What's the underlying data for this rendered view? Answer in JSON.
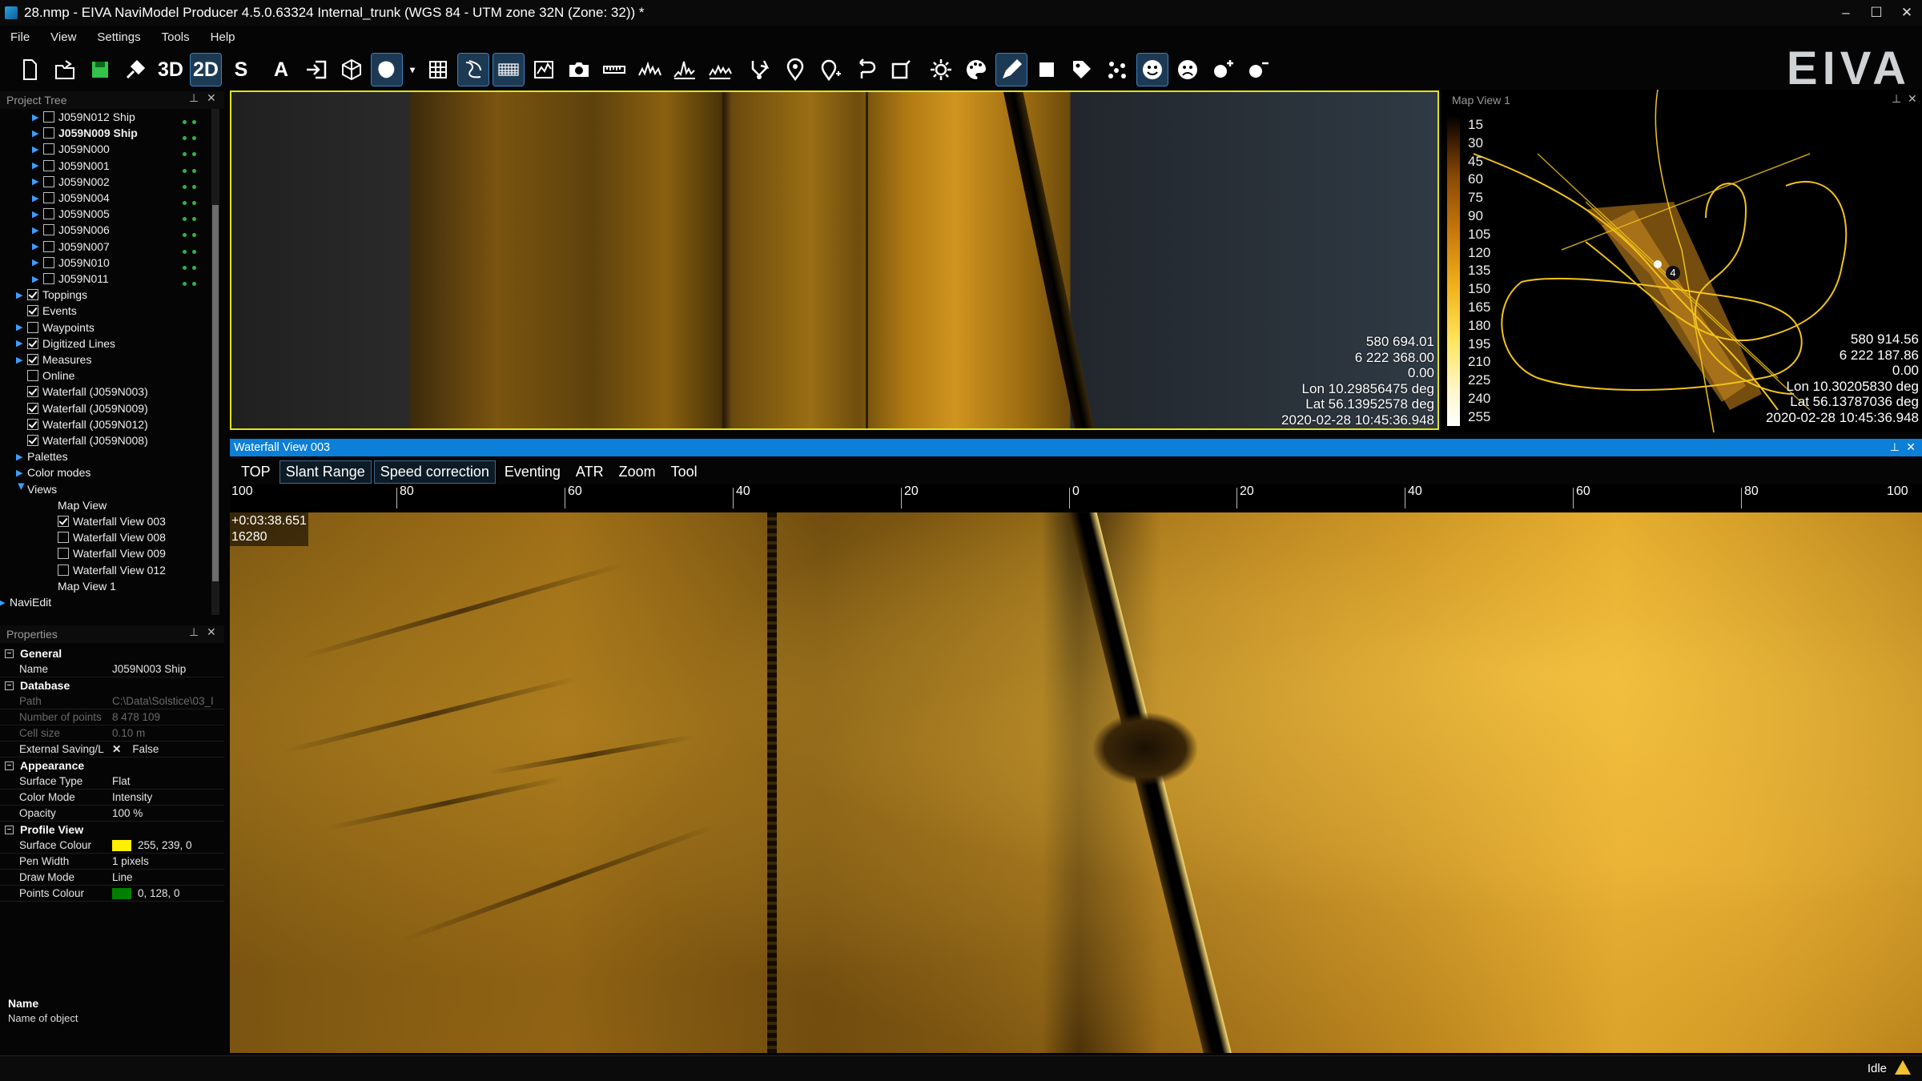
{
  "window": {
    "title": "28.nmp - EIVA NaviModel Producer 4.5.0.63324 Internal_trunk (WGS 84 - UTM zone 32N (Zone: 32)) *",
    "minimize": "–",
    "maximize": "☐",
    "close": "✕",
    "logo": "EIVA"
  },
  "menu": [
    "File",
    "View",
    "Settings",
    "Tools",
    "Help"
  ],
  "toolbar": {
    "b3d": "3D",
    "b2d": "2D",
    "bs": "S",
    "ba": "A"
  },
  "project_tree": {
    "title": "Project Tree",
    "items": [
      {
        "label": "J059N012 Ship",
        "checked": false,
        "bold": false
      },
      {
        "label": "J059N009 Ship",
        "checked": false,
        "bold": true
      },
      {
        "label": "J059N000",
        "checked": false
      },
      {
        "label": "J059N001",
        "checked": false
      },
      {
        "label": "J059N002",
        "checked": false
      },
      {
        "label": "J059N004",
        "checked": false
      },
      {
        "label": "J059N005",
        "checked": false
      },
      {
        "label": "J059N006",
        "checked": false
      },
      {
        "label": "J059N007",
        "checked": false
      },
      {
        "label": "J059N010",
        "checked": false
      },
      {
        "label": "J059N011",
        "checked": false
      },
      {
        "label": "Toppings",
        "checked": true
      },
      {
        "label": "Events",
        "checked": true
      },
      {
        "label": "Waypoints",
        "checked": false
      },
      {
        "label": "Digitized Lines",
        "checked": true
      },
      {
        "label": "Measures",
        "checked": true
      },
      {
        "label": "Online",
        "checked": false
      },
      {
        "label": "Waterfall (J059N003)",
        "checked": true
      },
      {
        "label": "Waterfall (J059N009)",
        "checked": true
      },
      {
        "label": "Waterfall (J059N012)",
        "checked": true
      },
      {
        "label": "Waterfall (J059N008)",
        "checked": true
      },
      {
        "label": "Palettes"
      },
      {
        "label": "Color modes"
      },
      {
        "label": "Views"
      },
      {
        "label": "Map View"
      },
      {
        "label": "Waterfall View 003",
        "checked": true
      },
      {
        "label": "Waterfall View 008",
        "checked": false
      },
      {
        "label": "Waterfall View 009",
        "checked": false
      },
      {
        "label": "Waterfall View 012",
        "checked": false
      },
      {
        "label": "Map View 1"
      },
      {
        "label": "NaviEdit"
      }
    ]
  },
  "properties": {
    "title": "Properties",
    "sections": {
      "general": "General",
      "database": "Database",
      "appearance": "Appearance",
      "profile": "Profile View"
    },
    "rows": {
      "name_k": "Name",
      "name_v": "J059N003 Ship",
      "path_k": "Path",
      "path_v": "C:\\Data\\Solstice\\03_I",
      "points_k": "Number of points",
      "points_v": "8 478 109",
      "cell_k": "Cell size",
      "cell_v": "0.10 m",
      "ext_k": "External Saving/L",
      "ext_x": "✕",
      "ext_v": "False",
      "surf_k": "Surface Type",
      "surf_v": "Flat",
      "cmode_k": "Color Mode",
      "cmode_v": "Intensity",
      "opac_k": "Opacity",
      "opac_v": "100 %",
      "scol_k": "Surface Colour",
      "scol_v": "255, 239, 0",
      "pen_k": "Pen Width",
      "pen_v": "1 pixels",
      "draw_k": "Draw Mode",
      "draw_v": "Line",
      "pcol_k": "Points Colour",
      "pcol_v": "0, 128, 0"
    },
    "colors": {
      "surface": "#ffef00",
      "points": "#008000"
    },
    "help": {
      "name": "Name",
      "desc": "Name of object"
    }
  },
  "top_view": {
    "readout": [
      "580 694.01",
      "6 222 368.00",
      "0.00",
      "Lon 10.29856475 deg",
      "Lat 56.13952578 deg",
      "2020-02-28 10:45:36.948"
    ]
  },
  "map_view": {
    "title": "Map View 1",
    "legend": [
      "15",
      "30",
      "45",
      "60",
      "75",
      "90",
      "105",
      "120",
      "135",
      "150",
      "165",
      "180",
      "195",
      "210",
      "225",
      "240",
      "255"
    ],
    "marker": "4",
    "readout": [
      "580 914.56",
      "6 222 187.86",
      "0.00",
      "Lon 10.30205830 deg",
      "Lat 56.13787036 deg",
      "2020-02-28 10:45:36.948"
    ]
  },
  "waterfall": {
    "title": "Waterfall View 003",
    "tabs": [
      "TOP",
      "Slant Range",
      "Speed correction",
      "Eventing",
      "ATR",
      "Zoom",
      "Tool"
    ],
    "ruler": [
      "100",
      "80",
      "60",
      "40",
      "20",
      "0",
      "20",
      "40",
      "60",
      "80",
      "100"
    ],
    "time": "+0:03:38.651",
    "ping": "16280"
  },
  "status": {
    "text": "Idle"
  },
  "accent": "#0c7fd8"
}
